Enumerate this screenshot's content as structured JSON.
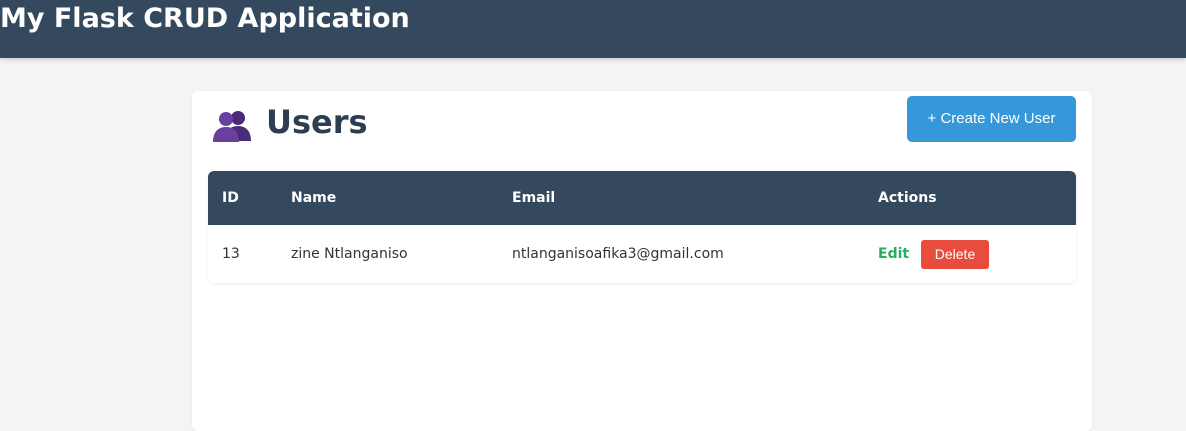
{
  "app": {
    "title": "My Flask CRUD Application"
  },
  "page": {
    "title": "Users",
    "icon": "users-icon"
  },
  "toolbar": {
    "create_label": "+ Create New User"
  },
  "table": {
    "columns": [
      "ID",
      "Name",
      "Email",
      "Actions"
    ],
    "rows": [
      {
        "id": "13",
        "name": "zine Ntlanganiso",
        "email": "ntlanganisoafika3@gmail.com",
        "edit_label": "Edit",
        "delete_label": "Delete"
      }
    ]
  },
  "colors": {
    "header_bg": "#34495e",
    "primary": "#3498db",
    "success": "#27ae60",
    "danger": "#e74c3c",
    "page_bg": "#f3f4f6",
    "title_text": "#2c3e50"
  }
}
